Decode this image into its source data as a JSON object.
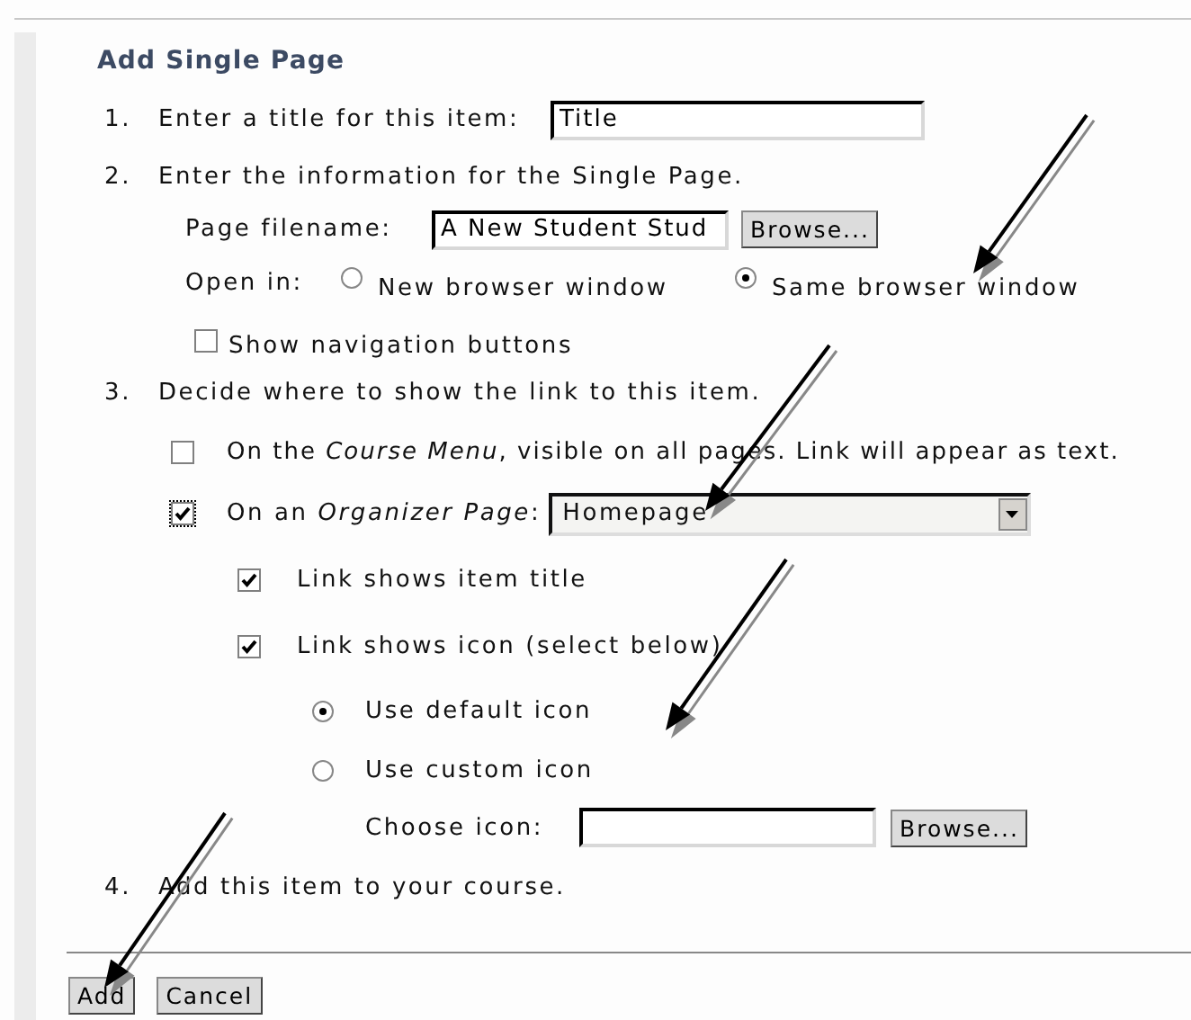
{
  "heading": "Add Single Page",
  "step1": {
    "number": "1.",
    "label": "Enter a title for this item:",
    "title_value": "Title"
  },
  "step2": {
    "number": "2.",
    "label": "Enter the information for the Single Page.",
    "filename_label": "Page filename:",
    "filename_value": "A New Student Stud",
    "browse": "Browse...",
    "open_in_label": "Open in:",
    "open_options": [
      {
        "label": "New browser window",
        "selected": false
      },
      {
        "label": "Same browser window",
        "selected": true
      }
    ],
    "show_nav": {
      "label": "Show navigation buttons",
      "checked": false
    }
  },
  "step3": {
    "number": "3.",
    "label": "Decide where to show the link to this item.",
    "course_menu": {
      "label": "On the *Course Menu*, visible on all pages. Link will appear as text.",
      "checked": false
    },
    "organizer": {
      "label": "On an *Organizer Page*:",
      "checked": true,
      "dropdown": "Homepage"
    },
    "link_options": [
      {
        "label": "Link shows item title",
        "checked": true
      },
      {
        "label": "Link shows icon (select below)",
        "checked": true
      }
    ],
    "icon_options": [
      {
        "label": "Use default icon",
        "selected": true
      },
      {
        "label": "Use custom icon",
        "selected": false
      }
    ],
    "choose_icon_label": "Choose icon:",
    "browse": "Browse..."
  },
  "step4": {
    "number": "4.",
    "label": "Add this item to your course."
  },
  "buttons": [
    "Add",
    "Cancel"
  ]
}
